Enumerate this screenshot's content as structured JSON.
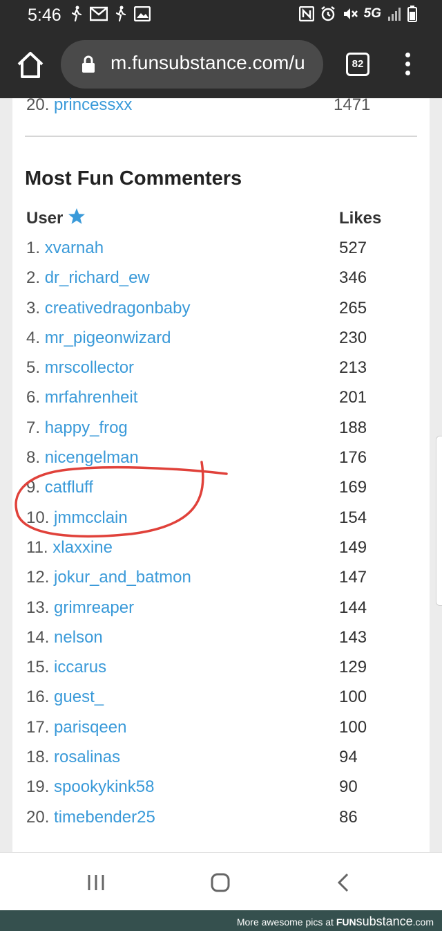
{
  "status_bar": {
    "time": "5:46",
    "left_icons": [
      "walking-person-icon",
      "gmail-icon",
      "walking-person-icon",
      "image-icon"
    ],
    "right_icons": [
      "nfc-icon",
      "alarm-icon",
      "mute-icon",
      "signal-icon",
      "battery-icon"
    ],
    "network": "5G"
  },
  "browser": {
    "url": "m.funsubstance.com/u",
    "tab_count": "82"
  },
  "previous_list": {
    "last_row": {
      "rank": "20.",
      "user": "princessxx",
      "value": "1471"
    }
  },
  "section": {
    "title": "Most Fun Commenters",
    "col_user": "User",
    "col_likes": "Likes"
  },
  "rows": [
    {
      "rank": "1.",
      "user": "xvarnah",
      "likes": "527"
    },
    {
      "rank": "2.",
      "user": "dr_richard_ew",
      "likes": "346"
    },
    {
      "rank": "3.",
      "user": "creativedragonbaby",
      "likes": "265"
    },
    {
      "rank": "4.",
      "user": "mr_pigeonwizard",
      "likes": "230"
    },
    {
      "rank": "5.",
      "user": "mrscollector",
      "likes": "213"
    },
    {
      "rank": "6.",
      "user": "mrfahrenheit",
      "likes": "201"
    },
    {
      "rank": "7.",
      "user": "happy_frog",
      "likes": "188"
    },
    {
      "rank": "8.",
      "user": "nicengelman",
      "likes": "176"
    },
    {
      "rank": "9.",
      "user": "catfluff",
      "likes": "169"
    },
    {
      "rank": "10.",
      "user": "jmmcclain",
      "likes": "154"
    },
    {
      "rank": "11.",
      "user": "xlaxxine",
      "likes": "149"
    },
    {
      "rank": "12.",
      "user": "jokur_and_batmon",
      "likes": "147"
    },
    {
      "rank": "13.",
      "user": "grimreaper",
      "likes": "144"
    },
    {
      "rank": "14.",
      "user": "nelson",
      "likes": "143"
    },
    {
      "rank": "15.",
      "user": "iccarus",
      "likes": "129"
    },
    {
      "rank": "16.",
      "user": "guest_",
      "likes": "100"
    },
    {
      "rank": "17.",
      "user": "parisqeen",
      "likes": "100"
    },
    {
      "rank": "18.",
      "user": "rosalinas",
      "likes": "94"
    },
    {
      "rank": "19.",
      "user": "spookykink58",
      "likes": "90"
    },
    {
      "rank": "20.",
      "user": "timebender25",
      "likes": "86"
    }
  ],
  "footer": {
    "prefix": "More awesome pics at",
    "brand_a": "FUN",
    "brand_b": "substance",
    "brand_c": ".com"
  },
  "colors": {
    "link": "#3a9ad9",
    "annotation": "#e0413a",
    "chrome_dark": "#2b2b2b",
    "footer_bg": "#35504e"
  }
}
